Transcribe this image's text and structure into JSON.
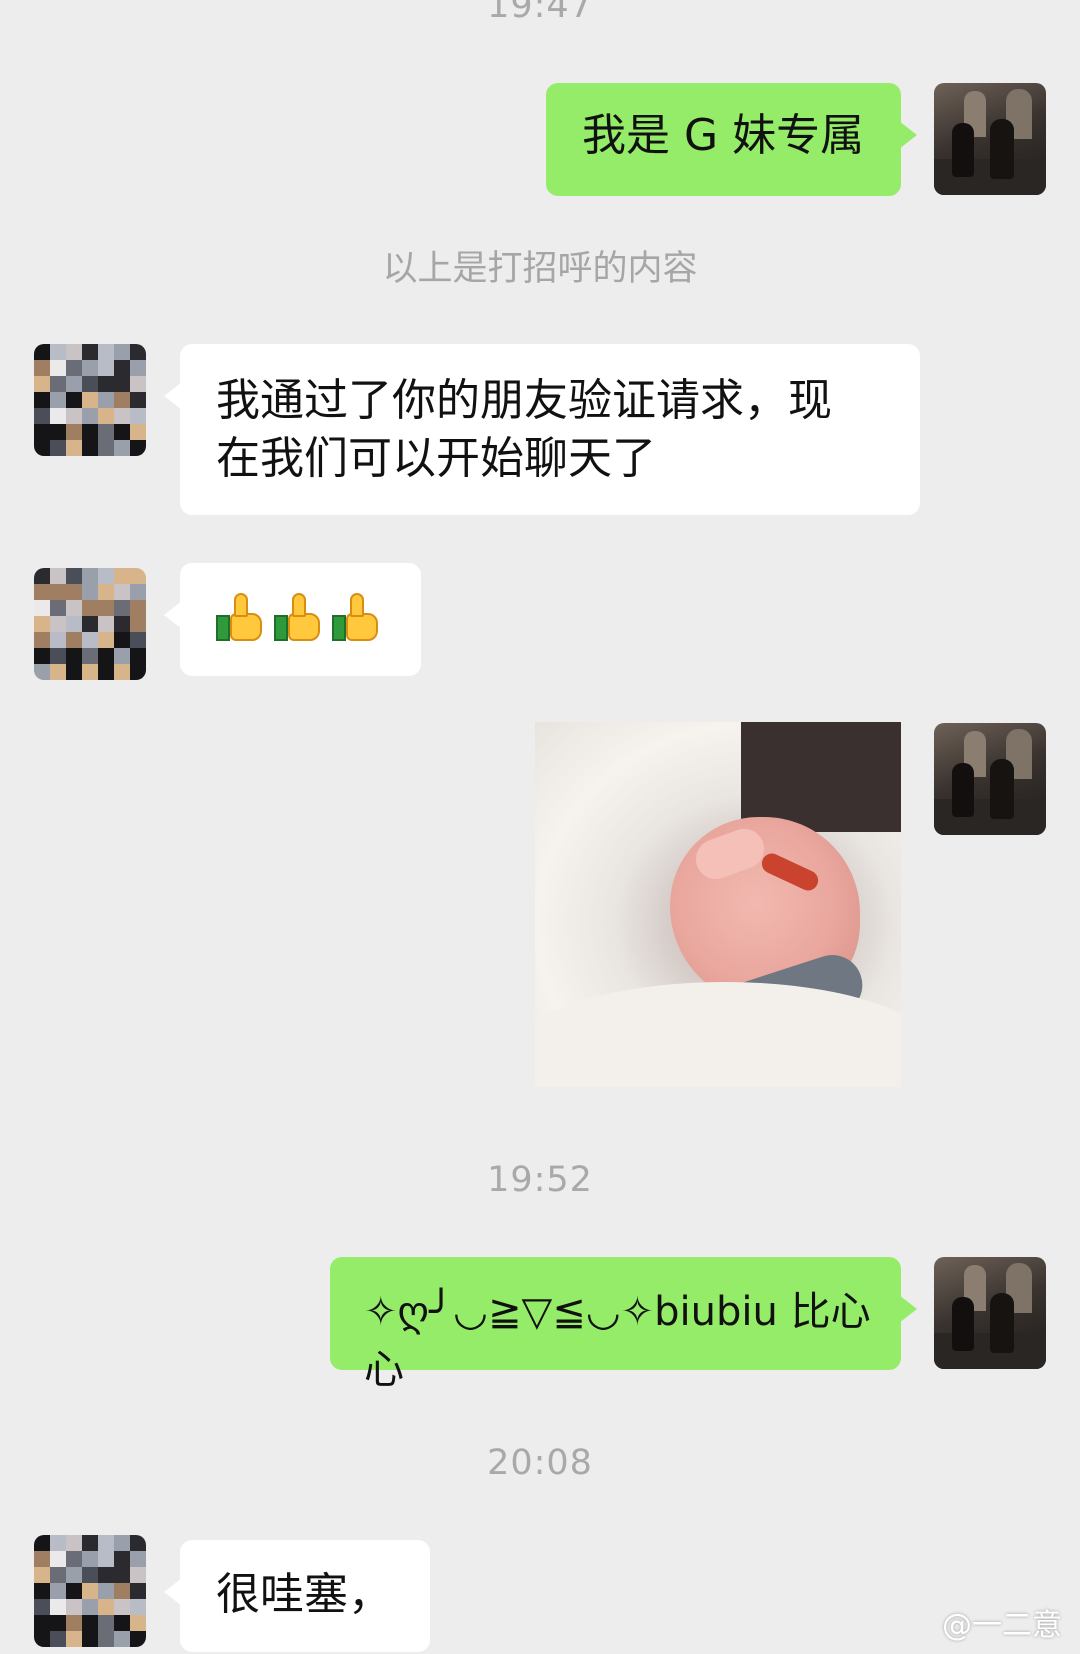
{
  "chat": {
    "timestamps": [
      "19:47",
      "19:52",
      "20:08"
    ],
    "system_note": "以上是打招呼的内容",
    "messages": {
      "m1": "我是 G 妹专属",
      "m2_line1": "我通过了你的朋友验证请求，现",
      "m2_line2": "在我们可以开始聊天了",
      "m3": "👍👍👍",
      "m5": "✧ღ╯◡≧▽≦◡✧biubiu 比心心",
      "m6": "很哇塞，"
    }
  },
  "watermark": "@一二意",
  "colors": {
    "background": "#ededed",
    "self_bubble": "#95ec69",
    "friend_bubble": "#ffffff",
    "timestamp": "#a9a9a9"
  }
}
